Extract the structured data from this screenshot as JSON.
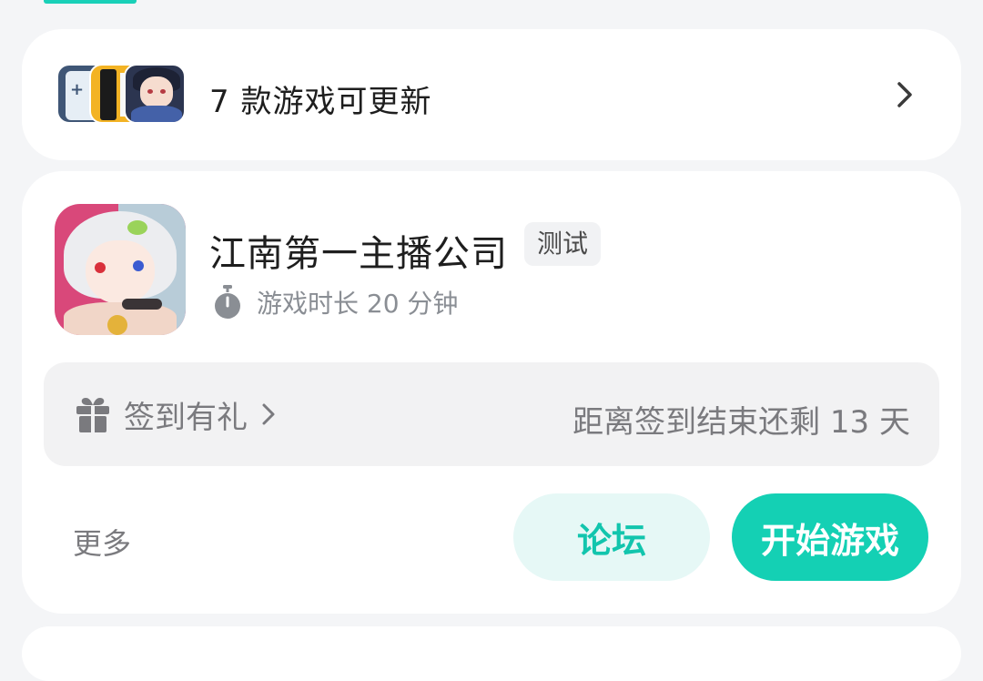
{
  "update_card": {
    "text": "7 款游戏可更新",
    "thumbnails": [
      "game-thumb-1",
      "game-thumb-2",
      "game-thumb-3"
    ],
    "chevron_icon": "chevron-right-icon"
  },
  "game_card": {
    "title": "江南第一主播公司",
    "badge": "测试",
    "playtime_icon": "timer-icon",
    "playtime": "游戏时长 20 分钟",
    "signin": {
      "icon": "gift-icon",
      "label": "签到有礼",
      "countdown": "距离签到结束还剩 13 天"
    },
    "more_label": "更多",
    "forum_button": "论坛",
    "start_button": "开始游戏"
  },
  "colors": {
    "accent": "#14d0b4",
    "accent_soft": "#e6f8f6",
    "background": "#f4f5f7",
    "card": "#ffffff"
  }
}
